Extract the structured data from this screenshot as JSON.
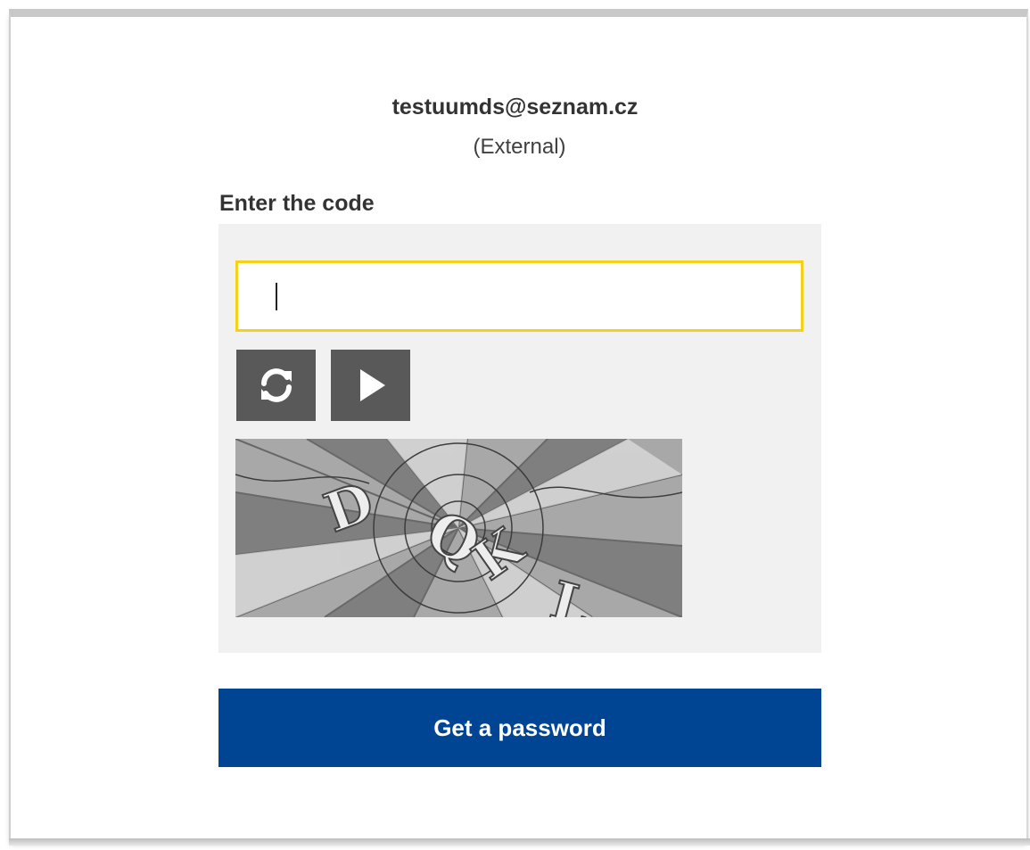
{
  "account": {
    "email": "testuumds@seznam.cz",
    "type": "(External)"
  },
  "captcha": {
    "label": "Enter the code",
    "input_value": "",
    "refresh_icon": "refresh-icon",
    "play_icon": "play-audio-icon",
    "image_text": "DQKL"
  },
  "actions": {
    "submit_label": "Get a password"
  },
  "colors": {
    "input_border": "#f5d11c",
    "panel_bg": "#f1f1f1",
    "icon_button_bg": "#595959",
    "primary_button": "#004494"
  }
}
